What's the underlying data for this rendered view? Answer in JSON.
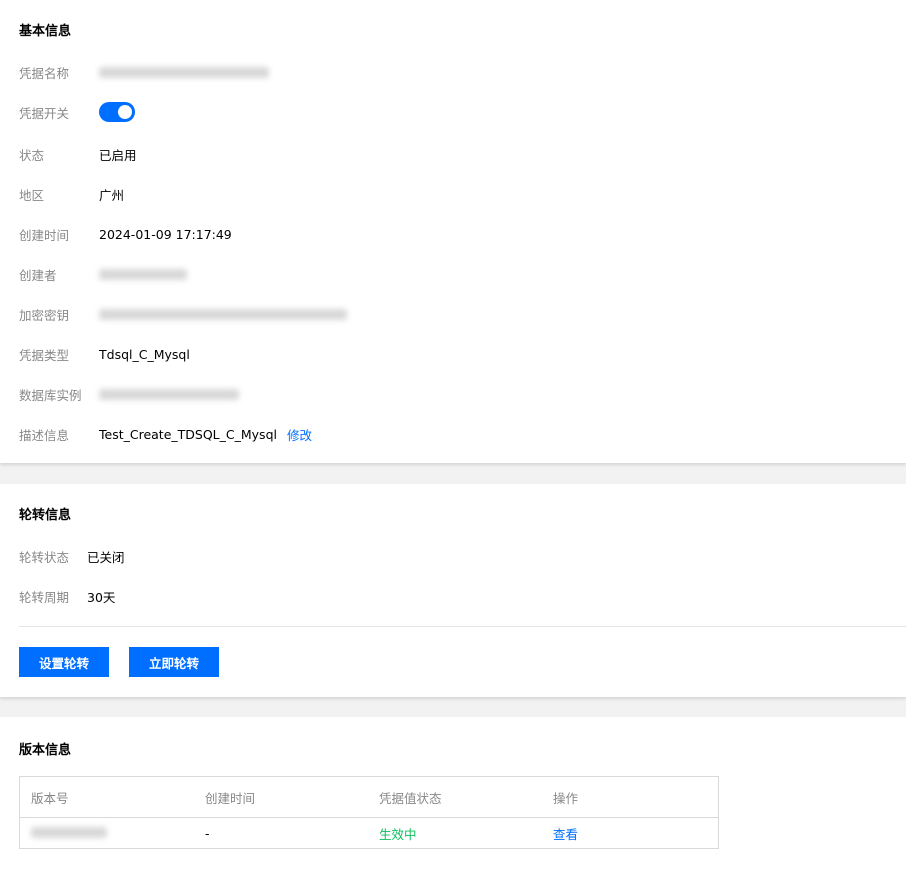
{
  "basic": {
    "title": "基本信息",
    "name_label": "凭据名称",
    "switch_label": "凭据开关",
    "switch_on": true,
    "status_label": "状态",
    "status_value": "已启用",
    "region_label": "地区",
    "region_value": "广州",
    "created_label": "创建时间",
    "created_value": "2024-01-09 17:17:49",
    "creator_label": "创建者",
    "kms_label": "加密密钥",
    "type_label": "凭据类型",
    "type_value": "Tdsql_C_Mysql",
    "instance_label": "数据库实例",
    "desc_label": "描述信息",
    "desc_value": "Test_Create_TDSQL_C_Mysql",
    "desc_edit": "修改"
  },
  "rotation": {
    "title": "轮转信息",
    "status_label": "轮转状态",
    "status_value": "已关闭",
    "period_label": "轮转周期",
    "period_value": "30天",
    "set_button": "设置轮转",
    "now_button": "立即轮转"
  },
  "versions": {
    "title": "版本信息",
    "columns": [
      "版本号",
      "创建时间",
      "凭据值状态",
      "操作"
    ],
    "rows": [
      {
        "created": "-",
        "status": "生效中",
        "action": "查看"
      }
    ]
  },
  "colors": {
    "primary": "#006eff",
    "success": "#0abf5b"
  }
}
